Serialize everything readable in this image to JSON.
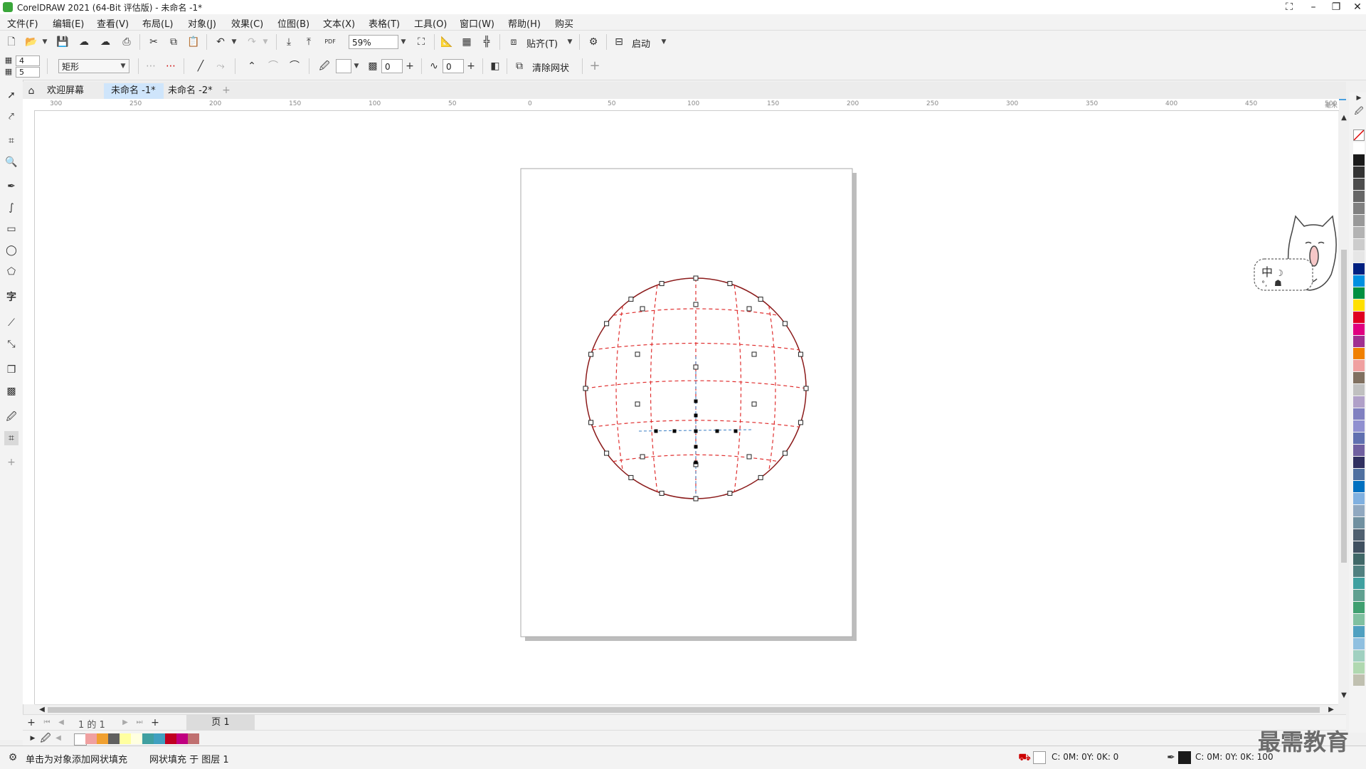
{
  "window": {
    "title": "CorelDRAW 2021 (64-Bit 评估版) - 未命名 -1*"
  },
  "menu": [
    "文件(F)",
    "编辑(E)",
    "查看(V)",
    "布局(L)",
    "对象(J)",
    "效果(C)",
    "位图(B)",
    "文本(X)",
    "表格(T)",
    "工具(O)",
    "窗口(W)",
    "帮助(H)",
    "购买"
  ],
  "toolbar": {
    "zoom": "59%",
    "snap_label": "贴齐(T)",
    "launch_label": "启动",
    "pdf_label": "PDF"
  },
  "propbar": {
    "grid_cols": "4",
    "grid_rows": "5",
    "shape_select": "矩形",
    "transparency_value": "0",
    "smoothing_value": "0",
    "clear_mesh_label": "清除网状"
  },
  "tabs": [
    {
      "label": "欢迎屏幕"
    },
    {
      "label": "未命名 -1*"
    },
    {
      "label": "未命名 -2*"
    }
  ],
  "ruler": {
    "h_labels": [
      "300",
      "250",
      "200",
      "150",
      "100",
      "50",
      "0",
      "50",
      "100",
      "150",
      "200",
      "250",
      "300",
      "350",
      "400",
      "450",
      "500"
    ],
    "h_unit": "毫米"
  },
  "pagenav": {
    "page_of": "1 的 1",
    "page_tab": "页 1"
  },
  "status": {
    "hint": "单击为对象添加网状填充",
    "object_info": "网状填充 于 图层 1",
    "fill_cmyk": "C: 0M: 0Y: 0K: 0",
    "outline_cmyk": "C: 0M: 0Y: 0K: 100"
  },
  "watermark": "最需教育",
  "sticker": {
    "label": "中"
  },
  "colors": {
    "accent": "#4aa0e0",
    "mesh_line": "#e03030",
    "outline": "#8b1a1a",
    "doc_palette": [
      "#ffffff",
      "#f0a0a0",
      "#f0a030",
      "#606060",
      "#ffffa0",
      "#ffffe0",
      "#40a0a0",
      "#40a0c0",
      "#c00020",
      "#c00080",
      "#c07070"
    ],
    "palette": [
      "#ffffff",
      "#1a1a1a",
      "#333333",
      "#4d4d4d",
      "#666666",
      "#808080",
      "#999999",
      "#b3b3b3",
      "#cccccc",
      "#e6e6e6",
      "#002080",
      "#0090e0",
      "#009040",
      "#ffe000",
      "#e00020",
      "#e00080",
      "#a03090",
      "#f08000",
      "#f0a0a0",
      "#807060",
      "#c0c0c0",
      "#b0a0c8",
      "#8080c0",
      "#9090d0",
      "#6070b0",
      "#7060a0",
      "#303060",
      "#5070a0",
      "#0070c0",
      "#80b0e0",
      "#90a8c0",
      "#7090a0",
      "#506070",
      "#405060",
      "#406868",
      "#508080",
      "#40a0a0",
      "#60a090",
      "#40a070",
      "#80c0a0",
      "#50a0c0",
      "#90c0e0",
      "#a0d0c0",
      "#b0d8b0",
      "#c0c0b0"
    ]
  }
}
